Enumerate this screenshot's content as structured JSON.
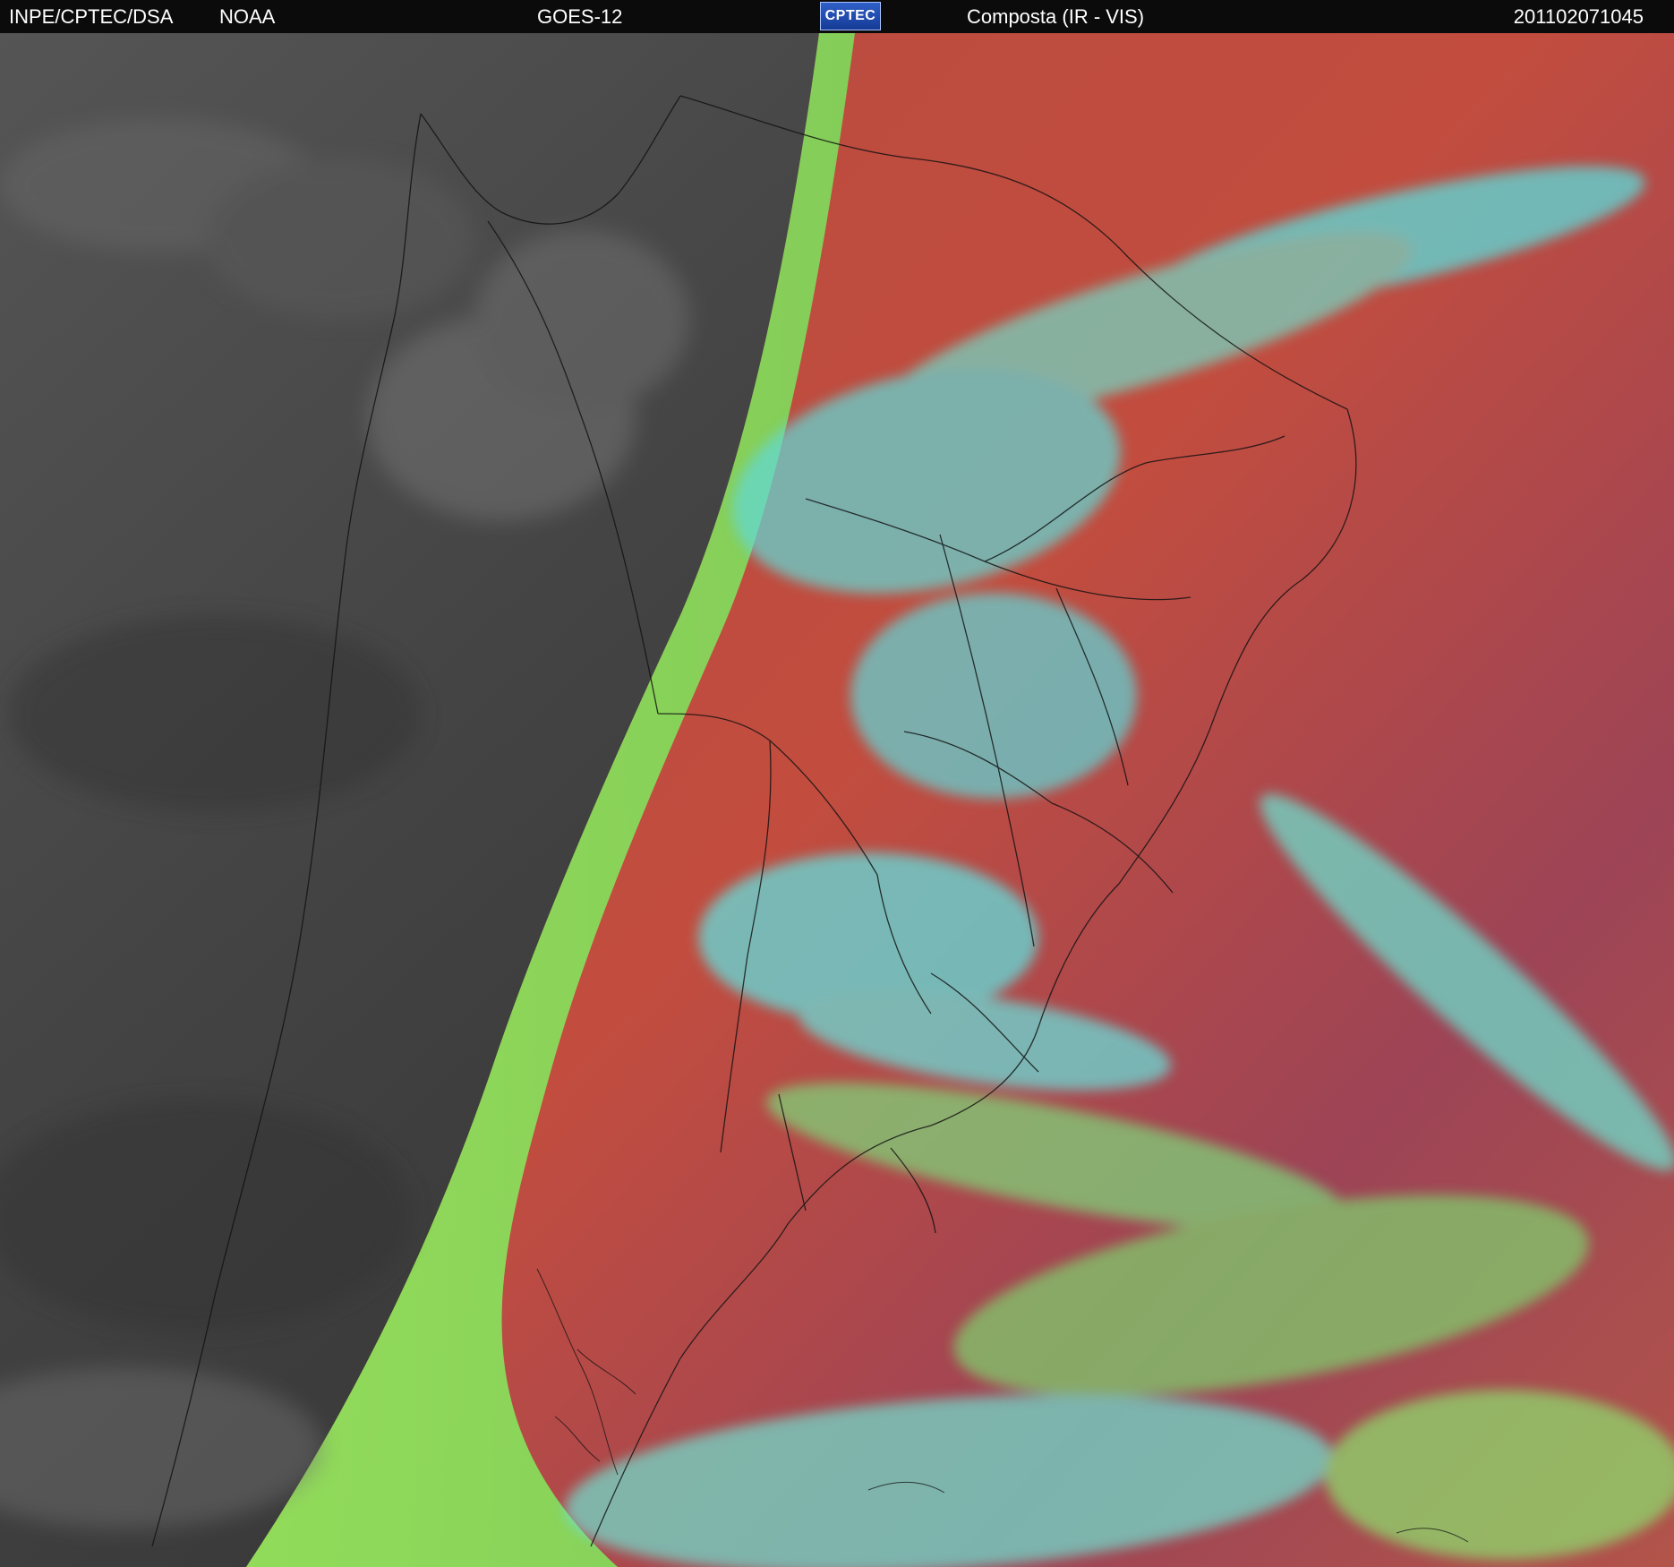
{
  "header": {
    "agency": "INPE/CPTEC/DSA",
    "noaa": "NOAA",
    "satellite": "GOES-12",
    "logo_text": "CPTEC",
    "product": "Composta (IR - VIS)",
    "timestamp": "201102071045"
  },
  "colors": {
    "night_gray": "#444444",
    "terminator_green": "#92e85a",
    "day_red": "#b74a3f",
    "cloud_cyan": "#57e3e3",
    "cloud_green": "#8ee46b",
    "outline": "#111111"
  },
  "icons": {
    "logo": "cptec-logo-icon"
  }
}
